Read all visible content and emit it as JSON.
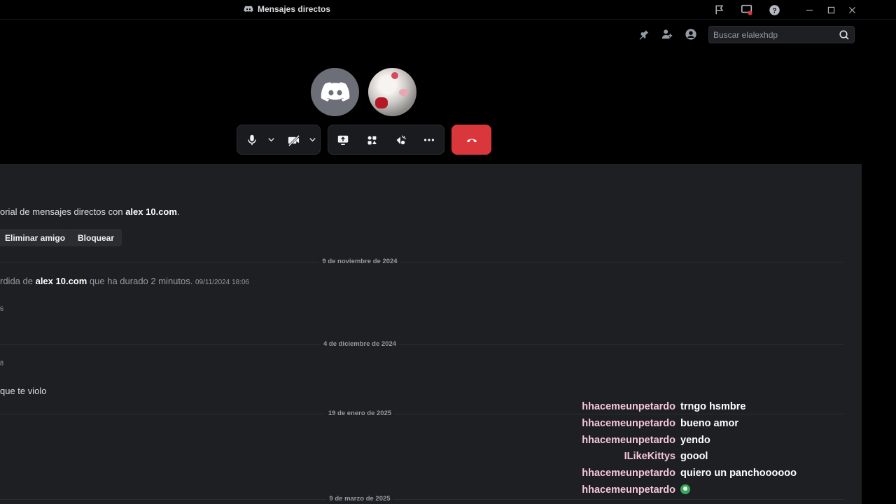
{
  "titlebar": {
    "title": "Mensajes directos"
  },
  "search": {
    "placeholder": "Buscar elalexhdp"
  },
  "chat": {
    "intro_prefix": "orial de mensajes directos con ",
    "intro_user": "alex 10.com",
    "intro_suffix": ".",
    "remove_friend": "Eliminar amigo",
    "block": "Bloquear",
    "date_1": "9 de noviembre de 2024",
    "missed_prefix": "rdida de ",
    "missed_user": "alex 10.com",
    "missed_suffix": " que ha durado 2 minutos.",
    "missed_time": "09/11/2024 18:06",
    "frag_1": "6",
    "date_2": "4 de diciembre de 2024",
    "frag_2": "8",
    "msg_fragment": "que te violo",
    "date_3": "19 de enero de 2025",
    "date_4": "9 de marzo de 2025"
  },
  "overlay": [
    {
      "user": "hhacemeunpetardo",
      "text": "trngo hsmbre"
    },
    {
      "user": "hhacemeunpetardo",
      "text": "bueno amor"
    },
    {
      "user": "hhacemeunpetardo",
      "text": "yendo"
    },
    {
      "user": "ILikeKittys",
      "text": "goool"
    },
    {
      "user": "hhacemeunpetardo",
      "text": "quiero un panchoooooo"
    },
    {
      "user": "hhacemeunpetardo",
      "text": ""
    }
  ],
  "colors": {
    "accent_red": "#da373c",
    "username_pink": "#f5c6d6",
    "chat_bg": "#1e1f22"
  },
  "icons": {
    "overlay_emoji": "green-smile-emoji"
  }
}
